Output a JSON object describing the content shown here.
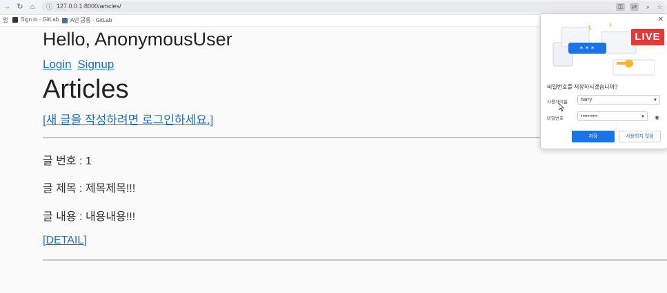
{
  "browser": {
    "url": "127.0.0.1:8000/articles/",
    "bookmarks": [
      {
        "label": "Sign in · GitLab"
      },
      {
        "label": "A반 공통 · GitLab"
      }
    ],
    "bookmarks_prefix": "앱"
  },
  "page": {
    "greeting": "Hello, AnonymousUser",
    "login_link": "Login",
    "signup_link": "Signup",
    "title": "Articles",
    "new_article_link": "[새 글을 작성하려면 로그인하세요.]",
    "article": {
      "number": "글 번호 : 1",
      "title": "글 제목 : 제목제목!!!",
      "content": "글 내용 : 내용내용!!!",
      "detail_link": "[DETAIL]"
    }
  },
  "password_popup": {
    "badge": "LIVE",
    "masked_sample": "* * *",
    "question": "비밀번호를 저장하시겠습니까?",
    "username_label": "사용자이름",
    "username_value": "harry",
    "password_label": "비밀번호",
    "password_value": "••••••••••",
    "save_button": "저장",
    "never_button": "사용하지 않음"
  },
  "colors": {
    "link": "#1a6fcf",
    "accent": "#1a73e8",
    "live_badge": "#e53935"
  }
}
